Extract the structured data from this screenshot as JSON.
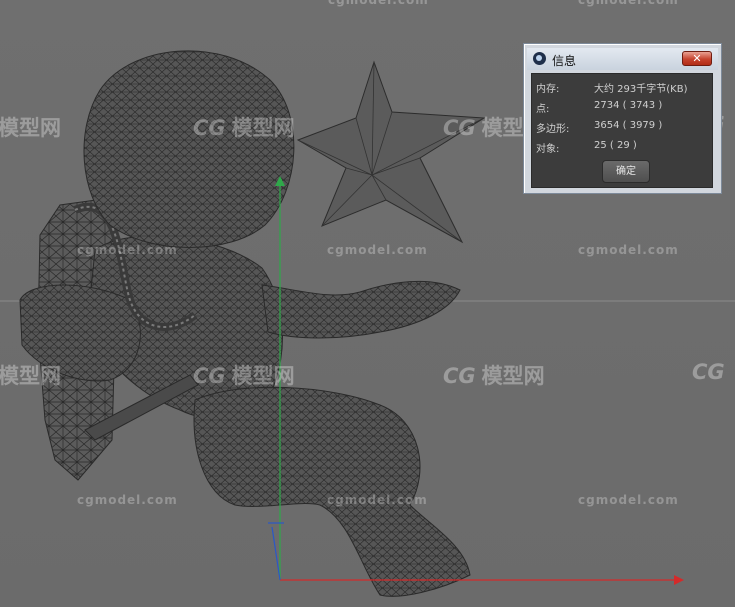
{
  "dialog": {
    "title": "信息",
    "close_glyph": "✕",
    "rows": [
      {
        "label": "内存:",
        "value": "大约 293千字节(KB)"
      },
      {
        "label": "点:",
        "value": "2734 ( 3743 )"
      },
      {
        "label": "多边形:",
        "value": "3654 ( 3979 )"
      },
      {
        "label": "对象:",
        "value": "25 ( 29 )"
      }
    ],
    "ok_label": "确定"
  },
  "watermark": {
    "site": "cgmodel.com",
    "logo_mark": "CG",
    "logo_text": "模型网"
  },
  "colors": {
    "viewport_bg": "#6e6e6e",
    "mesh_fill": "#5a5a5a",
    "mesh_wire": "#2a2a2a",
    "axis_y": "#2fa84a",
    "axis_x": "#d42a2a",
    "axis_z": "#2a58c8"
  },
  "icons": {
    "app_icon": "cinema4d-logo-icon",
    "close_icon": "close-icon"
  }
}
